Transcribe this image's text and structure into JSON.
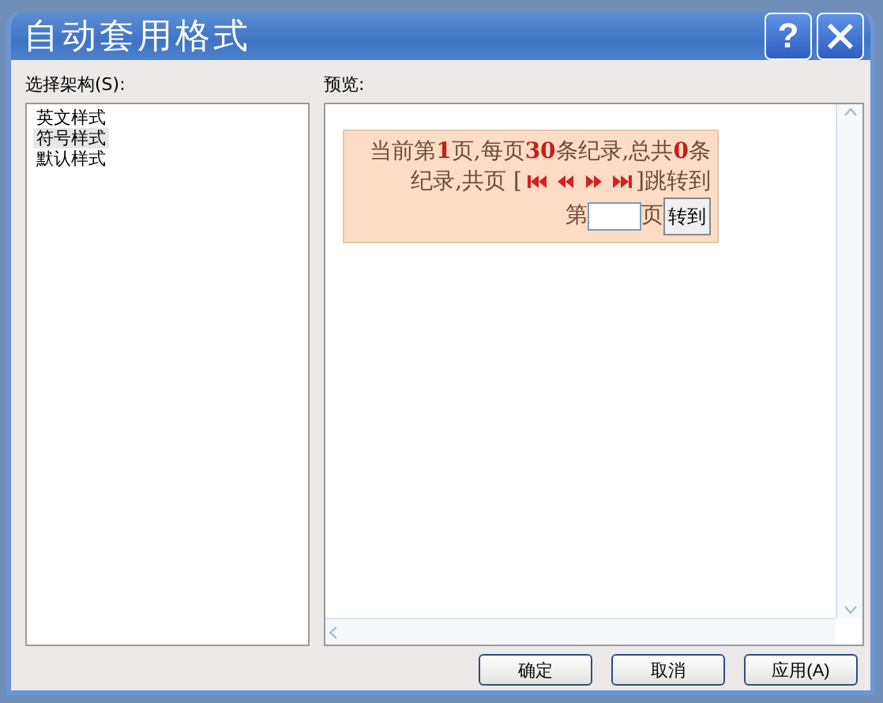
{
  "window": {
    "title": "自动套用格式",
    "help_button": "?"
  },
  "scheme_list": {
    "label": "选择架构(S):",
    "items": [
      {
        "label": "英文样式",
        "selected": false
      },
      {
        "label": "符号样式",
        "selected": true
      },
      {
        "label": "默认样式",
        "selected": false
      }
    ]
  },
  "preview": {
    "label": "预览:",
    "pager": {
      "status": "当前第**1**页,每页**30**条纪录,总共**0**条",
      "status_line_2": "纪录,共页 [",
      "after_nav": "]跳转到",
      "page_prefix": "第",
      "page_suffix": "页",
      "go_button": "转到"
    }
  },
  "buttons": [
    "确定",
    "取消",
    "应用(A)"
  ]
}
